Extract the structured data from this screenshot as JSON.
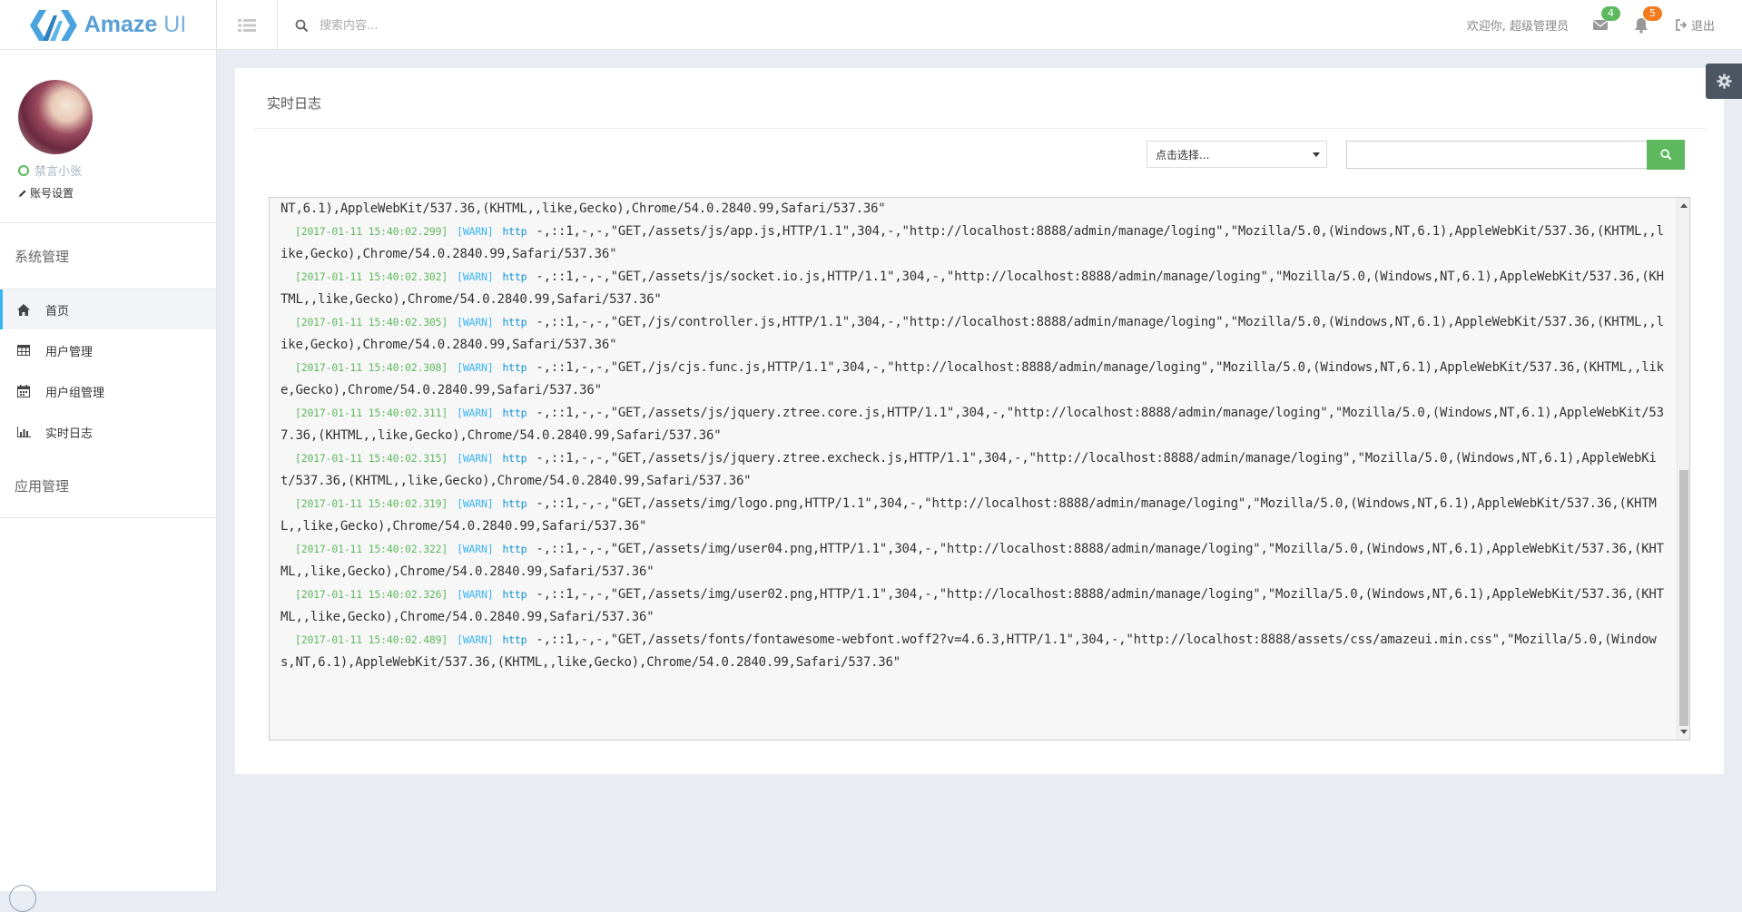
{
  "brand": {
    "name_bold": "Amaze ",
    "name_light": "UI"
  },
  "header": {
    "search_placeholder": "搜索内容...",
    "welcome": "欢迎你, 超级管理员",
    "mail_count": "4",
    "notice_count": "5",
    "logout": "退出"
  },
  "sidebar": {
    "user_name": "禁言小张",
    "account_settings": "账号设置",
    "section_system": "系统管理",
    "items": [
      {
        "label": "首页",
        "icon": "home-icon"
      },
      {
        "label": "用户管理",
        "icon": "table-icon"
      },
      {
        "label": "用户组管理",
        "icon": "calendar-icon"
      },
      {
        "label": "实时日志",
        "icon": "bar-chart-icon"
      }
    ],
    "section_apps": "应用管理"
  },
  "main": {
    "title": "实时日志",
    "select_placeholder": "点击选择...",
    "search_value": "",
    "log_first_partial": "NT,6.1),AppleWebKit/537.36,(KHTML,,like,Gecko),Chrome/54.0.2840.99,Safari/537.36\"",
    "log_lines": [
      {
        "time": "[2017-01-11 15:40:02.299]",
        "level": "[WARN]",
        "source": "http",
        "message": "-,::1,-,-,\"GET,/assets/js/app.js,HTTP/1.1\",304,-,\"http://localhost:8888/admin/manage/loging\",\"Mozilla/5.0,(Windows,NT,6.1),AppleWebKit/537.36,(KHTML,,like,Gecko),Chrome/54.0.2840.99,Safari/537.36\""
      },
      {
        "time": "[2017-01-11 15:40:02.302]",
        "level": "[WARN]",
        "source": "http",
        "message": "-,::1,-,-,\"GET,/assets/js/socket.io.js,HTTP/1.1\",304,-,\"http://localhost:8888/admin/manage/loging\",\"Mozilla/5.0,(Windows,NT,6.1),AppleWebKit/537.36,(KHTML,,like,Gecko),Chrome/54.0.2840.99,Safari/537.36\""
      },
      {
        "time": "[2017-01-11 15:40:02.305]",
        "level": "[WARN]",
        "source": "http",
        "message": "-,::1,-,-,\"GET,/js/controller.js,HTTP/1.1\",304,-,\"http://localhost:8888/admin/manage/loging\",\"Mozilla/5.0,(Windows,NT,6.1),AppleWebKit/537.36,(KHTML,,like,Gecko),Chrome/54.0.2840.99,Safari/537.36\""
      },
      {
        "time": "[2017-01-11 15:40:02.308]",
        "level": "[WARN]",
        "source": "http",
        "message": "-,::1,-,-,\"GET,/js/cjs.func.js,HTTP/1.1\",304,-,\"http://localhost:8888/admin/manage/loging\",\"Mozilla/5.0,(Windows,NT,6.1),AppleWebKit/537.36,(KHTML,,like,Gecko),Chrome/54.0.2840.99,Safari/537.36\""
      },
      {
        "time": "[2017-01-11 15:40:02.311]",
        "level": "[WARN]",
        "source": "http",
        "message": "-,::1,-,-,\"GET,/assets/js/jquery.ztree.core.js,HTTP/1.1\",304,-,\"http://localhost:8888/admin/manage/loging\",\"Mozilla/5.0,(Windows,NT,6.1),AppleWebKit/537.36,(KHTML,,like,Gecko),Chrome/54.0.2840.99,Safari/537.36\""
      },
      {
        "time": "[2017-01-11 15:40:02.315]",
        "level": "[WARN]",
        "source": "http",
        "message": "-,::1,-,-,\"GET,/assets/js/jquery.ztree.excheck.js,HTTP/1.1\",304,-,\"http://localhost:8888/admin/manage/loging\",\"Mozilla/5.0,(Windows,NT,6.1),AppleWebKit/537.36,(KHTML,,like,Gecko),Chrome/54.0.2840.99,Safari/537.36\""
      },
      {
        "time": "[2017-01-11 15:40:02.319]",
        "level": "[WARN]",
        "source": "http",
        "message": "-,::1,-,-,\"GET,/assets/img/logo.png,HTTP/1.1\",304,-,\"http://localhost:8888/admin/manage/loging\",\"Mozilla/5.0,(Windows,NT,6.1),AppleWebKit/537.36,(KHTML,,like,Gecko),Chrome/54.0.2840.99,Safari/537.36\""
      },
      {
        "time": "[2017-01-11 15:40:02.322]",
        "level": "[WARN]",
        "source": "http",
        "message": "-,::1,-,-,\"GET,/assets/img/user04.png,HTTP/1.1\",304,-,\"http://localhost:8888/admin/manage/loging\",\"Mozilla/5.0,(Windows,NT,6.1),AppleWebKit/537.36,(KHTML,,like,Gecko),Chrome/54.0.2840.99,Safari/537.36\""
      },
      {
        "time": "[2017-01-11 15:40:02.326]",
        "level": "[WARN]",
        "source": "http",
        "message": "-,::1,-,-,\"GET,/assets/img/user02.png,HTTP/1.1\",304,-,\"http://localhost:8888/admin/manage/loging\",\"Mozilla/5.0,(Windows,NT,6.1),AppleWebKit/537.36,(KHTML,,like,Gecko),Chrome/54.0.2840.99,Safari/537.36\""
      },
      {
        "time": "[2017-01-11 15:40:02.489]",
        "level": "[WARN]",
        "source": "http",
        "message": "-,::1,-,-,\"GET,/assets/fonts/fontawesome-webfont.woff2?v=4.6.3,HTTP/1.1\",304,-,\"http://localhost:8888/assets/css/amazeui.min.css\",\"Mozilla/5.0,(Windows,NT,6.1),AppleWebKit/537.36,(KHTML,,like,Gecko),Chrome/54.0.2840.99,Safari/537.36\""
      }
    ]
  },
  "colors": {
    "accent": "#3bb4f2",
    "success": "#5eb95e",
    "warning": "#f37b1d",
    "page_bg": "#e9ecf3"
  }
}
